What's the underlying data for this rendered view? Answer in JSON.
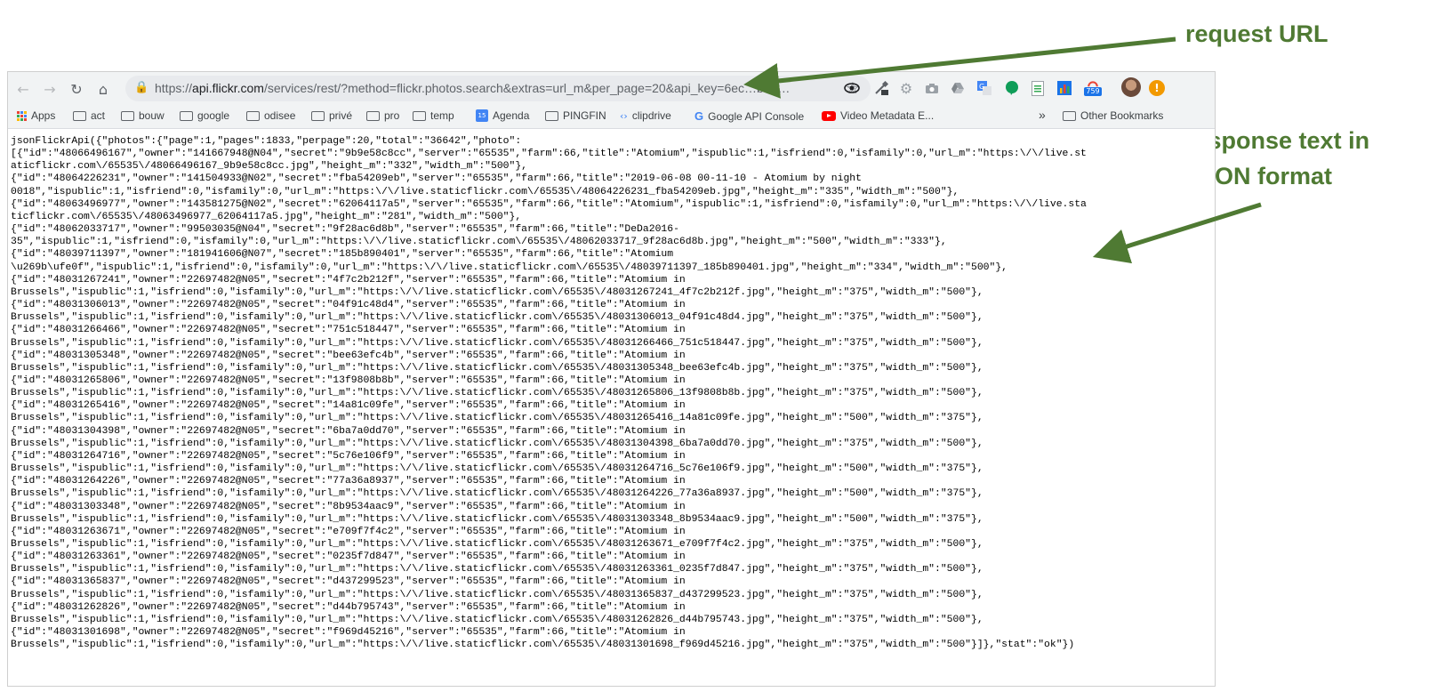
{
  "browser": {
    "url_scheme": "https://",
    "url_host": "api.flickr.com",
    "url_rest": "/services/rest/?method=flickr.photos.search&extras=url_m&per_page=20&api_key=6ec…bd4…",
    "badge_count": "759"
  },
  "bookmarks": {
    "apps": "Apps",
    "items": [
      "act",
      "bouw",
      "google",
      "odisee",
      "privé",
      "pro",
      "temp"
    ],
    "agenda": "Agenda",
    "pingfin": "PINGFIN",
    "clipdrive": "clipdrive",
    "google_api": "Google API Console",
    "video_meta": "Video Metadata E...",
    "overflow": "»",
    "other": "Other Bookmarks"
  },
  "response_lines": [
    "jsonFlickrApi({\"photos\":{\"page\":1,\"pages\":1833,\"perpage\":20,\"total\":\"36642\",\"photo\":",
    "[{\"id\":\"48066496167\",\"owner\":\"141667948@N04\",\"secret\":\"9b9e58c8cc\",\"server\":\"65535\",\"farm\":66,\"title\":\"Atomium\",\"ispublic\":1,\"isfriend\":0,\"isfamily\":0,\"url_m\":\"https:\\/\\/live.st",
    "aticflickr.com\\/65535\\/48066496167_9b9e58c8cc.jpg\",\"height_m\":\"332\",\"width_m\":\"500\"},",
    "{\"id\":\"48064226231\",\"owner\":\"141504933@N02\",\"secret\":\"fba54209eb\",\"server\":\"65535\",\"farm\":66,\"title\":\"2019-06-08 00-11-10 - Atomium by night",
    "0018\",\"ispublic\":1,\"isfriend\":0,\"isfamily\":0,\"url_m\":\"https:\\/\\/live.staticflickr.com\\/65535\\/48064226231_fba54209eb.jpg\",\"height_m\":\"335\",\"width_m\":\"500\"},",
    "{\"id\":\"48063496977\",\"owner\":\"143581275@N02\",\"secret\":\"62064117a5\",\"server\":\"65535\",\"farm\":66,\"title\":\"Atomium\",\"ispublic\":1,\"isfriend\":0,\"isfamily\":0,\"url_m\":\"https:\\/\\/live.sta",
    "ticflickr.com\\/65535\\/48063496977_62064117a5.jpg\",\"height_m\":\"281\",\"width_m\":\"500\"},",
    "{\"id\":\"48062033717\",\"owner\":\"99503035@N04\",\"secret\":\"9f28ac6d8b\",\"server\":\"65535\",\"farm\":66,\"title\":\"DeDa2016-",
    "35\",\"ispublic\":1,\"isfriend\":0,\"isfamily\":0,\"url_m\":\"https:\\/\\/live.staticflickr.com\\/65535\\/48062033717_9f28ac6d8b.jpg\",\"height_m\":\"500\",\"width_m\":\"333\"},",
    "{\"id\":\"48039711397\",\"owner\":\"181941606@N07\",\"secret\":\"185b890401\",\"server\":\"65535\",\"farm\":66,\"title\":\"Atomium",
    "\\u269b\\ufe0f\",\"ispublic\":1,\"isfriend\":0,\"isfamily\":0,\"url_m\":\"https:\\/\\/live.staticflickr.com\\/65535\\/48039711397_185b890401.jpg\",\"height_m\":\"334\",\"width_m\":\"500\"},",
    "{\"id\":\"48031267241\",\"owner\":\"22697482@N05\",\"secret\":\"4f7c2b212f\",\"server\":\"65535\",\"farm\":66,\"title\":\"Atomium in",
    "Brussels\",\"ispublic\":1,\"isfriend\":0,\"isfamily\":0,\"url_m\":\"https:\\/\\/live.staticflickr.com\\/65535\\/48031267241_4f7c2b212f.jpg\",\"height_m\":\"375\",\"width_m\":\"500\"},",
    "{\"id\":\"48031306013\",\"owner\":\"22697482@N05\",\"secret\":\"04f91c48d4\",\"server\":\"65535\",\"farm\":66,\"title\":\"Atomium in",
    "Brussels\",\"ispublic\":1,\"isfriend\":0,\"isfamily\":0,\"url_m\":\"https:\\/\\/live.staticflickr.com\\/65535\\/48031306013_04f91c48d4.jpg\",\"height_m\":\"375\",\"width_m\":\"500\"},",
    "{\"id\":\"48031266466\",\"owner\":\"22697482@N05\",\"secret\":\"751c518447\",\"server\":\"65535\",\"farm\":66,\"title\":\"Atomium in",
    "Brussels\",\"ispublic\":1,\"isfriend\":0,\"isfamily\":0,\"url_m\":\"https:\\/\\/live.staticflickr.com\\/65535\\/48031266466_751c518447.jpg\",\"height_m\":\"375\",\"width_m\":\"500\"},",
    "{\"id\":\"48031305348\",\"owner\":\"22697482@N05\",\"secret\":\"bee63efc4b\",\"server\":\"65535\",\"farm\":66,\"title\":\"Atomium in",
    "Brussels\",\"ispublic\":1,\"isfriend\":0,\"isfamily\":0,\"url_m\":\"https:\\/\\/live.staticflickr.com\\/65535\\/48031305348_bee63efc4b.jpg\",\"height_m\":\"375\",\"width_m\":\"500\"},",
    "{\"id\":\"48031265806\",\"owner\":\"22697482@N05\",\"secret\":\"13f9808b8b\",\"server\":\"65535\",\"farm\":66,\"title\":\"Atomium in",
    "Brussels\",\"ispublic\":1,\"isfriend\":0,\"isfamily\":0,\"url_m\":\"https:\\/\\/live.staticflickr.com\\/65535\\/48031265806_13f9808b8b.jpg\",\"height_m\":\"375\",\"width_m\":\"500\"},",
    "{\"id\":\"48031265416\",\"owner\":\"22697482@N05\",\"secret\":\"14a81c09fe\",\"server\":\"65535\",\"farm\":66,\"title\":\"Atomium in",
    "Brussels\",\"ispublic\":1,\"isfriend\":0,\"isfamily\":0,\"url_m\":\"https:\\/\\/live.staticflickr.com\\/65535\\/48031265416_14a81c09fe.jpg\",\"height_m\":\"500\",\"width_m\":\"375\"},",
    "{\"id\":\"48031304398\",\"owner\":\"22697482@N05\",\"secret\":\"6ba7a0dd70\",\"server\":\"65535\",\"farm\":66,\"title\":\"Atomium in",
    "Brussels\",\"ispublic\":1,\"isfriend\":0,\"isfamily\":0,\"url_m\":\"https:\\/\\/live.staticflickr.com\\/65535\\/48031304398_6ba7a0dd70.jpg\",\"height_m\":\"375\",\"width_m\":\"500\"},",
    "{\"id\":\"48031264716\",\"owner\":\"22697482@N05\",\"secret\":\"5c76e106f9\",\"server\":\"65535\",\"farm\":66,\"title\":\"Atomium in",
    "Brussels\",\"ispublic\":1,\"isfriend\":0,\"isfamily\":0,\"url_m\":\"https:\\/\\/live.staticflickr.com\\/65535\\/48031264716_5c76e106f9.jpg\",\"height_m\":\"500\",\"width_m\":\"375\"},",
    "{\"id\":\"48031264226\",\"owner\":\"22697482@N05\",\"secret\":\"77a36a8937\",\"server\":\"65535\",\"farm\":66,\"title\":\"Atomium in",
    "Brussels\",\"ispublic\":1,\"isfriend\":0,\"isfamily\":0,\"url_m\":\"https:\\/\\/live.staticflickr.com\\/65535\\/48031264226_77a36a8937.jpg\",\"height_m\":\"500\",\"width_m\":\"375\"},",
    "{\"id\":\"48031303348\",\"owner\":\"22697482@N05\",\"secret\":\"8b9534aac9\",\"server\":\"65535\",\"farm\":66,\"title\":\"Atomium in",
    "Brussels\",\"ispublic\":1,\"isfriend\":0,\"isfamily\":0,\"url_m\":\"https:\\/\\/live.staticflickr.com\\/65535\\/48031303348_8b9534aac9.jpg\",\"height_m\":\"500\",\"width_m\":\"375\"},",
    "{\"id\":\"48031263671\",\"owner\":\"22697482@N05\",\"secret\":\"e709f7f4c2\",\"server\":\"65535\",\"farm\":66,\"title\":\"Atomium in",
    "Brussels\",\"ispublic\":1,\"isfriend\":0,\"isfamily\":0,\"url_m\":\"https:\\/\\/live.staticflickr.com\\/65535\\/48031263671_e709f7f4c2.jpg\",\"height_m\":\"375\",\"width_m\":\"500\"},",
    "{\"id\":\"48031263361\",\"owner\":\"22697482@N05\",\"secret\":\"0235f7d847\",\"server\":\"65535\",\"farm\":66,\"title\":\"Atomium in",
    "Brussels\",\"ispublic\":1,\"isfriend\":0,\"isfamily\":0,\"url_m\":\"https:\\/\\/live.staticflickr.com\\/65535\\/48031263361_0235f7d847.jpg\",\"height_m\":\"375\",\"width_m\":\"500\"},",
    "{\"id\":\"48031365837\",\"owner\":\"22697482@N05\",\"secret\":\"d437299523\",\"server\":\"65535\",\"farm\":66,\"title\":\"Atomium in",
    "Brussels\",\"ispublic\":1,\"isfriend\":0,\"isfamily\":0,\"url_m\":\"https:\\/\\/live.staticflickr.com\\/65535\\/48031365837_d437299523.jpg\",\"height_m\":\"375\",\"width_m\":\"500\"},",
    "{\"id\":\"48031262826\",\"owner\":\"22697482@N05\",\"secret\":\"d44b795743\",\"server\":\"65535\",\"farm\":66,\"title\":\"Atomium in",
    "Brussels\",\"ispublic\":1,\"isfriend\":0,\"isfamily\":0,\"url_m\":\"https:\\/\\/live.staticflickr.com\\/65535\\/48031262826_d44b795743.jpg\",\"height_m\":\"375\",\"width_m\":\"500\"},",
    "{\"id\":\"48031301698\",\"owner\":\"22697482@N05\",\"secret\":\"f969d45216\",\"server\":\"65535\",\"farm\":66,\"title\":\"Atomium in",
    "Brussels\",\"ispublic\":1,\"isfriend\":0,\"isfamily\":0,\"url_m\":\"https:\\/\\/live.staticflickr.com\\/65535\\/48031301698_f969d45216.jpg\",\"height_m\":\"375\",\"width_m\":\"500\"}]},\"stat\":\"ok\"})"
  ],
  "annotations": {
    "request": "request URL",
    "response_line1": "response text in",
    "response_line2": "JSON format"
  },
  "colors": {
    "annotation": "#4f7a33",
    "toolbar": "#f1f3f4",
    "omnibox": "#e8eaed"
  }
}
